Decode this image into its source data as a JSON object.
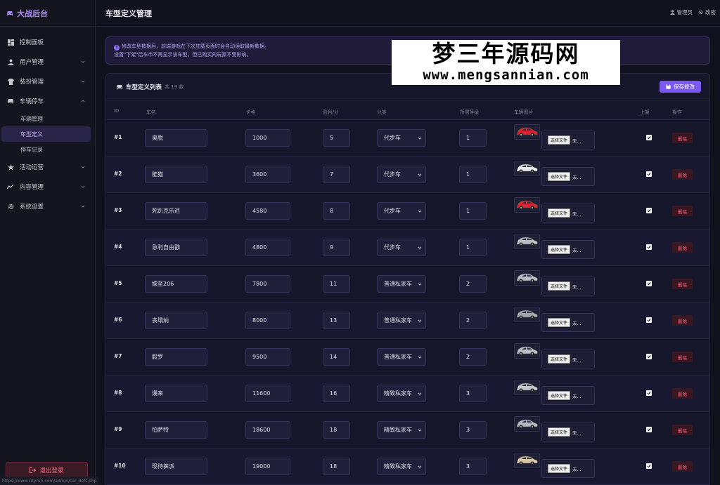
{
  "app": {
    "brand": "大战后台"
  },
  "nav": [
    {
      "label": "控制面板",
      "icon": "dashboard-icon",
      "expandable": false
    },
    {
      "label": "用户管理",
      "icon": "user-icon",
      "expandable": true
    },
    {
      "label": "装扮管理",
      "icon": "shirt-icon",
      "expandable": true
    },
    {
      "label": "车辆停车",
      "icon": "car-icon",
      "expandable": true,
      "open": true
    },
    {
      "label": "活动运营",
      "icon": "star-icon",
      "expandable": true
    },
    {
      "label": "内容管理",
      "icon": "chart-line-icon",
      "expandable": true
    },
    {
      "label": "系统设置",
      "icon": "gear-icon",
      "expandable": true
    }
  ],
  "nav_sub": [
    "车辆管理",
    "车型定义",
    "停车记录"
  ],
  "logout_label": "退出登录",
  "status_url": "https://www.cityrun.com/admin/car_defs.php",
  "topbar": {
    "title": "车型定义管理",
    "user": "管理员",
    "settings": "改密"
  },
  "notice": {
    "line1": "修改车型数据后，前端游戏在下次加载页面时会自动读取最新数据。",
    "line2": "设置\"下架\"后车市不再显示该车型，但已购买的玩家不受影响。"
  },
  "watermark": {
    "line1": "梦三年源码网",
    "line2": "www.mengsannian.com"
  },
  "card": {
    "title": "车型定义列表",
    "count": "共 19 款",
    "save_label": "保存修改"
  },
  "columns": [
    "ID",
    "车名",
    "价格",
    "盈利/分",
    "分类",
    "所需等级",
    "车辆图片",
    "上架",
    "操作"
  ],
  "file_button": "选择文件",
  "file_status": "未...",
  "delete_label": "删除",
  "rows": [
    {
      "id": "#1",
      "name": "奥脱",
      "price": "1000",
      "profit": "5",
      "category": "代步车",
      "level": "1",
      "color": "#d6262b"
    },
    {
      "id": "#2",
      "name": "能猫",
      "price": "3600",
      "profit": "7",
      "category": "代步车",
      "level": "1",
      "color": "#e9e9ec"
    },
    {
      "id": "#3",
      "name": "死趴克乐迟",
      "price": "4580",
      "profit": "8",
      "category": "代步车",
      "level": "1",
      "color": "#d32a2e"
    },
    {
      "id": "#4",
      "name": "急利自由戳",
      "price": "4800",
      "profit": "9",
      "category": "代步车",
      "level": "1",
      "color": "#b9bcc2"
    },
    {
      "id": "#5",
      "name": "嫖至206",
      "price": "7800",
      "profit": "11",
      "category": "普通私家车",
      "level": "2",
      "color": "#b9bcc2"
    },
    {
      "id": "#6",
      "name": "丧塌纳",
      "price": "8000",
      "profit": "13",
      "category": "普通私家车",
      "level": "2",
      "color": "#a3a6ac"
    },
    {
      "id": "#7",
      "name": "毅罗",
      "price": "9500",
      "profit": "14",
      "category": "普通私家车",
      "level": "2",
      "color": "#babdc3"
    },
    {
      "id": "#8",
      "name": "爆来",
      "price": "11600",
      "profit": "16",
      "category": "精致私家车",
      "level": "3",
      "color": "#c4c6cb"
    },
    {
      "id": "#9",
      "name": "怕萨特",
      "price": "18600",
      "profit": "18",
      "category": "精致私家车",
      "level": "3",
      "color": "#b4b7bd"
    },
    {
      "id": "#10",
      "name": "现待裤派",
      "price": "19000",
      "profit": "18",
      "category": "精致私家车",
      "level": "3",
      "color": "#d8c6a4"
    }
  ]
}
